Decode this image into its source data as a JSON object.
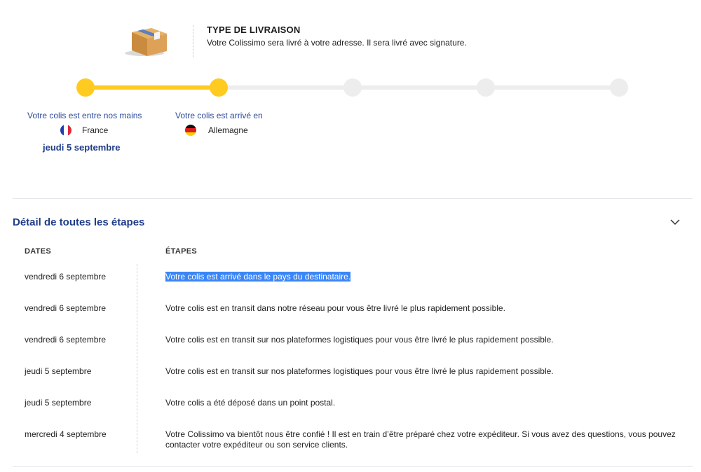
{
  "delivery": {
    "title": "TYPE DE LIVRAISON",
    "description": "Votre Colissimo sera livré à votre adresse. Il sera livré avec signature."
  },
  "tracker": {
    "progress_steps_completed": 2,
    "progress_steps_total": 5,
    "accent_color": "#ffcb21",
    "inactive_color": "#ededed",
    "step1": {
      "label": "Votre colis est entre nos mains",
      "country": "France",
      "date": "jeudi 5 septembre"
    },
    "step2": {
      "label": "Votre colis est arrivé en",
      "country": "Allemagne"
    }
  },
  "details": {
    "title": "Détail de toutes les étapes",
    "col_dates": "DATES",
    "col_steps": "ÉTAPES",
    "rows": [
      {
        "date": "vendredi 6 septembre",
        "step": "Votre colis est arrivé dans le pays du destinataire."
      },
      {
        "date": "vendredi 6 septembre",
        "step": "Votre colis est en transit dans notre réseau pour vous être livré le plus rapidement possible."
      },
      {
        "date": "vendredi 6 septembre",
        "step": "Votre colis est en transit sur nos plateformes logistiques pour vous être livré le plus rapidement possible."
      },
      {
        "date": "jeudi 5 septembre",
        "step": "Votre colis est en transit sur nos plateformes logistiques pour vous être livré le plus rapidement possible."
      },
      {
        "date": "jeudi 5 septembre",
        "step": "Votre colis a été déposé dans un point postal."
      },
      {
        "date": "mercredi 4 septembre",
        "step": "Votre Colissimo va bientôt nous être confié ! Il est en train d’être préparé chez votre expéditeur. Si vous avez des questions, vous pouvez contacter votre expéditeur ou son service clients."
      }
    ]
  },
  "icons": {
    "package": "package-icon",
    "flag_fr": "flag-france-icon",
    "flag_de": "flag-germany-icon",
    "chevron": "chevron-down-icon"
  },
  "colors": {
    "brand_blue": "#1f3c88",
    "selection": "#3b86f7"
  }
}
